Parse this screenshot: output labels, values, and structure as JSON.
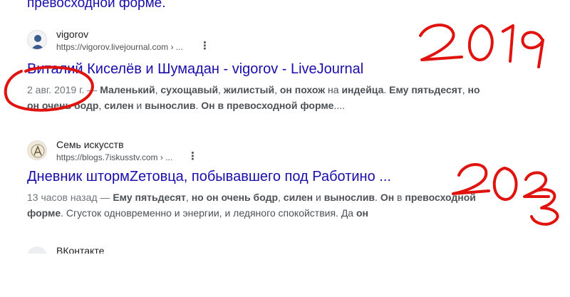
{
  "top_snippet": "превосходной форме.",
  "results": [
    {
      "site_name": "vigorov",
      "url": "https://vigorov.livejournal.com › ...",
      "title": "Виталий Киселёв и Шумадан - vigorov - LiveJournal",
      "date": "2 авг. 2019 г.",
      "snippet_parts": [
        "Маленький",
        ", ",
        "сухощавый",
        ", ",
        "жилистый",
        ", ",
        "он похож",
        " на ",
        "индейца",
        ". ",
        "Ему пятьдесят",
        ", ",
        "но он очень бодр",
        ", ",
        "силен",
        " и ",
        "вынослив",
        ". ",
        "Он в превосходной форме",
        "...."
      ]
    },
    {
      "site_name": "Семь искусств",
      "url": "https://blogs.7iskusstv.com › ...",
      "title": "Дневник штормZетовца, побывавшего под Работино ...",
      "date": "13 часов назад",
      "snippet_parts": [
        "Ему пятьдесят",
        ", ",
        "но он очень бодр",
        ", ",
        "силен",
        " и ",
        "вынослив",
        ". ",
        "Он",
        " в ",
        "превосходной форме",
        ". Сгусток одновременно и энергии, и ледяного спокойствия. Да ",
        "он",
        "..."
      ]
    }
  ],
  "partial_result": {
    "site_name": "ВКонтакте"
  },
  "annotations": {
    "year_a": "2019",
    "year_b": "2023",
    "color": "#e0130f"
  },
  "colors": {
    "link": "#1a0dab",
    "text": "#4d5156"
  }
}
